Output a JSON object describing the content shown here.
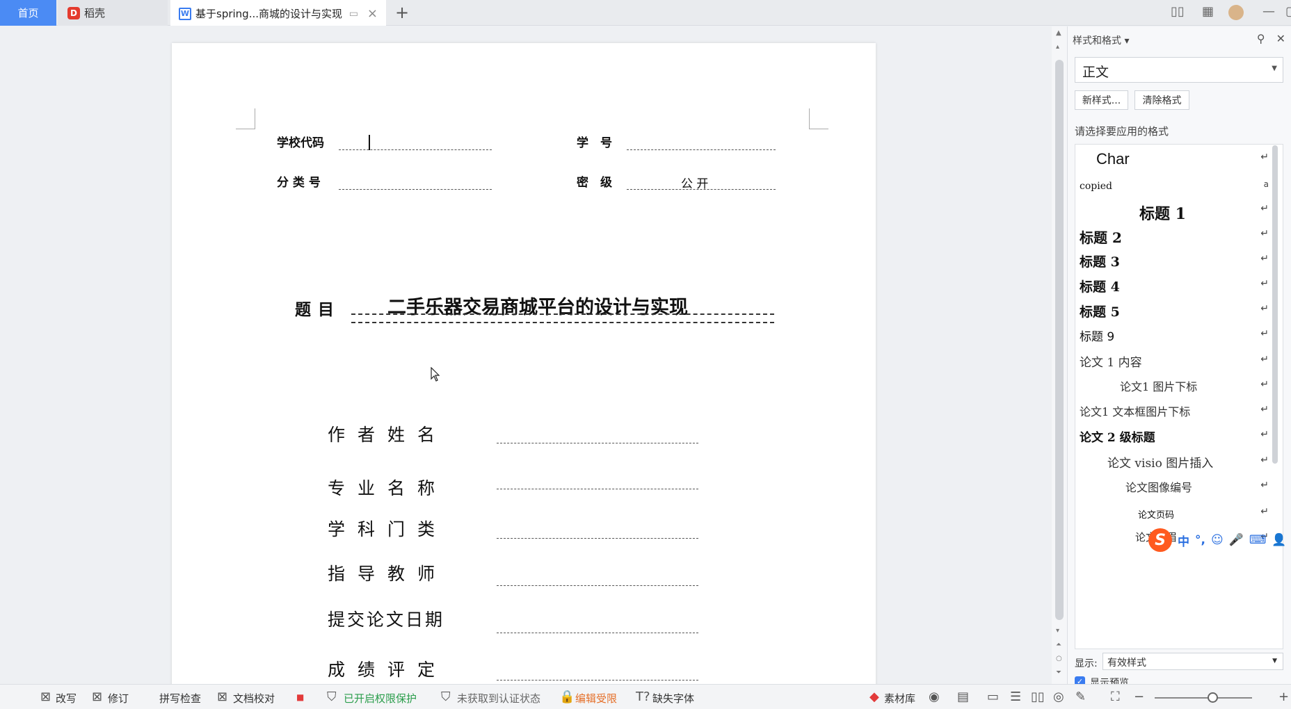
{
  "tabs": {
    "home": "首页",
    "daoke": "稻壳",
    "doc": "基于spring...商城的设计与实现",
    "doc_icon": "W"
  },
  "document": {
    "school_code_label": "学校代码",
    "student_id_label": "学　号",
    "category_label": "分 类 号",
    "secret_label": "密　级",
    "secret_value": "公 开",
    "title_label": "题目",
    "title_text": "二手乐器交易商城平台的设计与实现",
    "author_label": "作者姓名",
    "major_label": "专业名称",
    "discipline_label": "学科门类",
    "advisor_label": "指导教师",
    "submit_date_label": "提交论文日期",
    "grade_label": "成绩评定"
  },
  "panel": {
    "title": "样式和格式",
    "current_style": "正文",
    "new_style_btn": "新样式...",
    "clear_format_btn": "清除格式",
    "apply_prompt": "请选择要应用的格式",
    "styles": [
      "Char",
      "copied",
      "标题 1",
      "标题 2",
      "标题 3",
      "标题 4",
      "标题 5",
      "标题 9",
      "论文 1 内容",
      "论文1 图片下标",
      "论文1 文本框图片下标",
      "论文 2 级标题",
      "论文 visio 图片插入",
      "论文图像编号",
      "论文页码",
      "论文页眉"
    ],
    "show_label": "显示:",
    "show_value": "有效样式",
    "preview_label": "显示预览"
  },
  "ime": {
    "logo": "S",
    "items": [
      "中",
      "°,",
      "☺",
      "🎤",
      "⌨",
      "👤"
    ]
  },
  "statusbar": {
    "rewrite": "改写",
    "revise": "修订",
    "spellcheck": "拼写检查",
    "proofread": "文档校对",
    "permission": "已开启权限保护",
    "auth": "未获取到认证状态",
    "edit_limited": "编辑受限",
    "missing_font": "缺失字体",
    "material": "素材库"
  }
}
